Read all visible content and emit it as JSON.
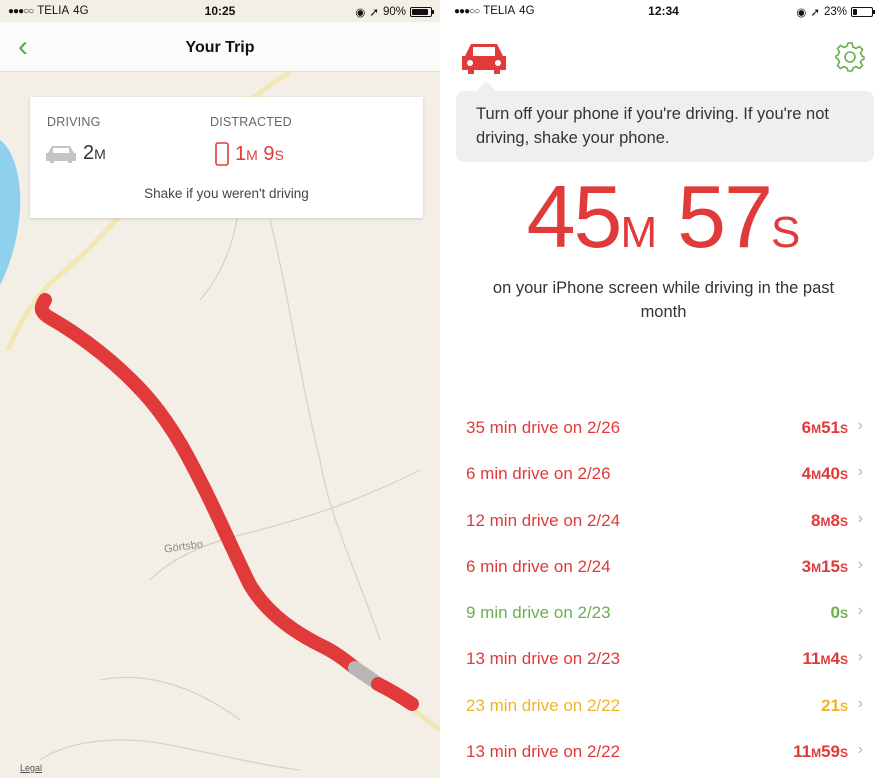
{
  "left": {
    "status": {
      "carrier": "TELIA",
      "network": "4G",
      "time": "10:25",
      "battery": "90%",
      "battery_level": 0.9
    },
    "nav": {
      "title": "Your Trip"
    },
    "card": {
      "driving_label": "DRIVING",
      "driving_num": "2",
      "driving_unit": "M",
      "distracted_label": "DISTRACTED",
      "distracted_num1": "1",
      "distracted_unit1": "M",
      "distracted_num2": " 9",
      "distracted_unit2": "S",
      "note": "Shake if you weren't driving"
    },
    "map": {
      "place": "Görtsbo",
      "legal": "Legal"
    }
  },
  "right": {
    "status": {
      "carrier": "TELIA",
      "network": "4G",
      "time": "12:34",
      "battery": "23%",
      "battery_level": 0.23
    },
    "tip": "Turn off your phone if you're driving. If you're not driving, shake your phone.",
    "total": {
      "minutes": "45",
      "minutes_unit": "M",
      "seconds": "57",
      "seconds_unit": "S"
    },
    "subtitle": "on your iPhone screen while driving in the past month",
    "drives": [
      {
        "label": "35 min drive on 2/26",
        "m": "6",
        "m_unit": "M",
        "s": "51",
        "s_unit": "S",
        "color": "#e03a3a"
      },
      {
        "label": "6 min drive on 2/26",
        "m": "4",
        "m_unit": "M",
        "s": "40",
        "s_unit": "S",
        "color": "#e03a3a"
      },
      {
        "label": "12 min drive on 2/24",
        "m": "8",
        "m_unit": "M",
        "s": "8",
        "s_unit": "S",
        "color": "#e03a3a"
      },
      {
        "label": "6 min drive on 2/24",
        "m": "3",
        "m_unit": "M",
        "s": "15",
        "s_unit": "S",
        "color": "#e03a3a"
      },
      {
        "label": "9 min drive on 2/23",
        "m": "",
        "m_unit": "",
        "s": "0",
        "s_unit": "S",
        "color": "#6ab04c"
      },
      {
        "label": "13 min drive on 2/23",
        "m": "11",
        "m_unit": "M",
        "s": "4",
        "s_unit": "S",
        "color": "#e03a3a"
      },
      {
        "label": "23 min drive on 2/22",
        "m": "",
        "m_unit": "",
        "s": "21",
        "s_unit": "S",
        "color": "#f0b429"
      },
      {
        "label": "13 min drive on 2/22",
        "m": "11",
        "m_unit": "M",
        "s": "59",
        "s_unit": "S",
        "color": "#e03a3a"
      }
    ]
  },
  "colors": {
    "accent_green": "#4caf50",
    "alert_red": "#e03a3a",
    "ok_green": "#6ab04c",
    "warn_yellow": "#f0b429",
    "route": "#e03a3a",
    "map_bg": "#f3efe6",
    "water": "#8fd0ee"
  },
  "icons": [
    "back-chevron-icon",
    "car-icon",
    "phone-icon",
    "gear-icon",
    "chevron-right-icon",
    "location-arrow-icon",
    "alarm-icon",
    "battery-icon"
  ]
}
